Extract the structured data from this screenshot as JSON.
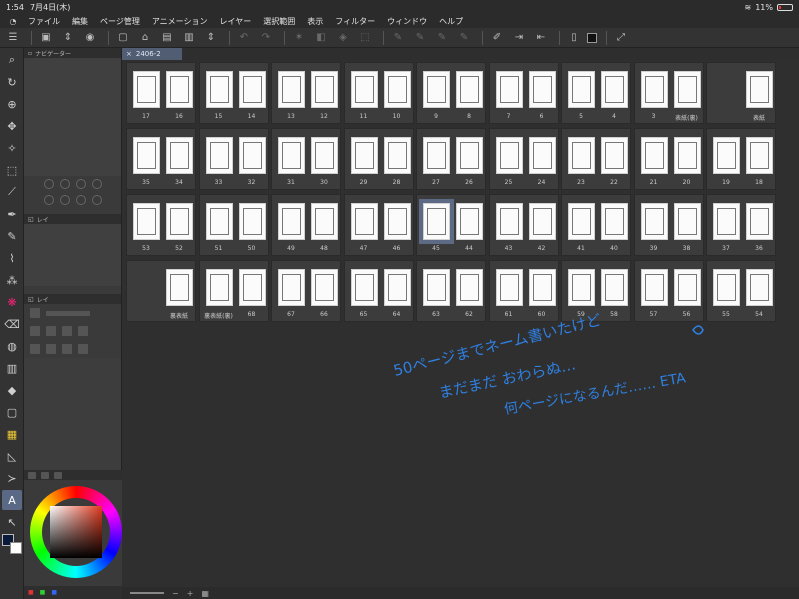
{
  "status": {
    "time": "1:54",
    "date": "7月4日(木)",
    "battery": "11%"
  },
  "menu": [
    "ファイル",
    "編集",
    "ページ管理",
    "アニメーション",
    "レイヤー",
    "選択範囲",
    "表示",
    "フィルター",
    "ウィンドウ",
    "ヘルプ"
  ],
  "panels": {
    "navigator": "ナビゲーター",
    "layer_short": "レイ"
  },
  "doc_tab": "2406-2",
  "rows": [
    [
      [
        "17",
        "16"
      ],
      [
        "15",
        "14"
      ],
      [
        "13",
        "12"
      ],
      [
        "11",
        "10"
      ],
      [
        "9",
        "8"
      ],
      [
        "7",
        "6"
      ],
      [
        "5",
        "4"
      ],
      [
        "3",
        "表紙(裏)"
      ],
      [
        "",
        "表紙"
      ]
    ],
    [
      [
        "35",
        "34"
      ],
      [
        "33",
        "32"
      ],
      [
        "31",
        "30"
      ],
      [
        "29",
        "28"
      ],
      [
        "27",
        "26"
      ],
      [
        "25",
        "24"
      ],
      [
        "23",
        "22"
      ],
      [
        "21",
        "20"
      ],
      [
        "19",
        "18"
      ]
    ],
    [
      [
        "53",
        "52"
      ],
      [
        "51",
        "50"
      ],
      [
        "49",
        "48"
      ],
      [
        "47",
        "46"
      ],
      [
        "45",
        "44"
      ],
      [
        "43",
        "42"
      ],
      [
        "41",
        "40"
      ],
      [
        "39",
        "38"
      ],
      [
        "37",
        "36"
      ]
    ],
    [
      [
        "",
        "裏表紙"
      ],
      [
        "裏表紙(裏)",
        "68"
      ],
      [
        "67",
        "66"
      ],
      [
        "65",
        "64"
      ],
      [
        "63",
        "62"
      ],
      [
        "61",
        "60"
      ],
      [
        "59",
        "58"
      ],
      [
        "57",
        "56"
      ],
      [
        "55",
        "54"
      ]
    ]
  ],
  "selected_page": "45",
  "handwritten": [
    "50ページまでネーム書いたけど",
    "まだまだ おわらぬ…",
    "何ページになるんだ…… ETA",
    "E"
  ],
  "colors": {
    "accent": "#5d6a85",
    "ink": "#2f7fe0"
  }
}
